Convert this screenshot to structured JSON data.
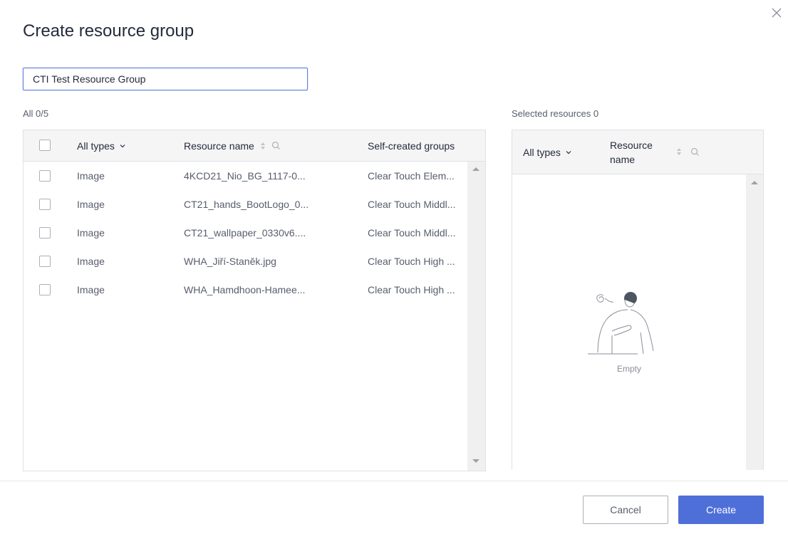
{
  "dialog": {
    "title": "Create resource group",
    "close_icon": "close-icon"
  },
  "name_input": {
    "value": "CTI Test Resource Group"
  },
  "left_panel": {
    "count_label": "All 0/5",
    "headers": {
      "type": "All types",
      "name": "Resource name",
      "groups": "Self-created groups"
    },
    "rows": [
      {
        "type": "Image",
        "name": "4KCD21_Nio_BG_1117-0...",
        "groups": "Clear Touch Elem..."
      },
      {
        "type": "Image",
        "name": "CT21_hands_BootLogo_0...",
        "groups": "Clear Touch Middl..."
      },
      {
        "type": "Image",
        "name": "CT21_wallpaper_0330v6....",
        "groups": "Clear Touch Middl..."
      },
      {
        "type": "Image",
        "name": "WHA_Jiří-Staněk.jpg",
        "groups": "Clear Touch High ..."
      },
      {
        "type": "Image",
        "name": "WHA_Hamdhoon-Hamee...",
        "groups": "Clear Touch High ..."
      }
    ]
  },
  "right_panel": {
    "count_label": "Selected resources 0",
    "headers": {
      "type": "All types",
      "name_line1": "Resource",
      "name_line2": "name"
    },
    "empty_text": "Empty"
  },
  "footer": {
    "cancel_label": "Cancel",
    "create_label": "Create"
  },
  "colors": {
    "primary": "#4f6fd8",
    "input_border": "#5e7ce0"
  }
}
